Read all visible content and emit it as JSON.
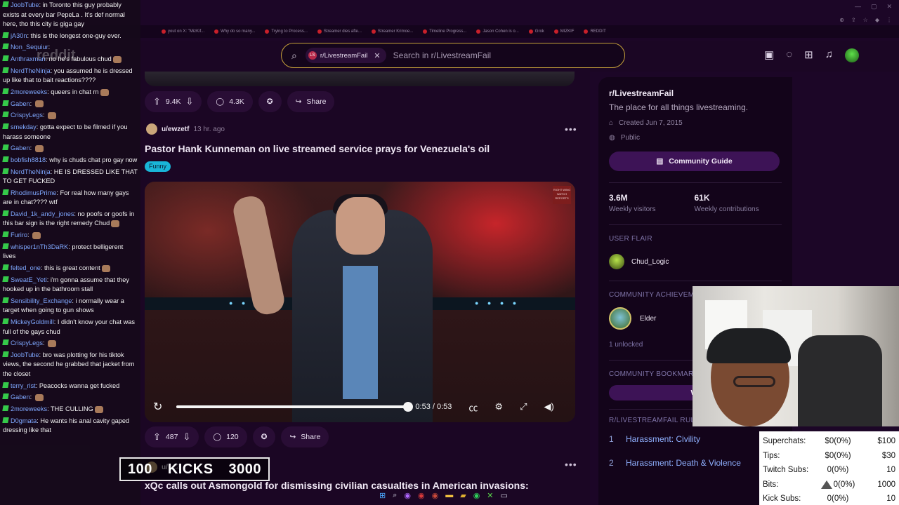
{
  "browser": {
    "bookmarks": [
      "yout on X: \"MizKif...",
      "Why do so many...",
      "Trying to Process...",
      "Streamer dies afte...",
      "Streamer Krimoe...",
      "Timeline Progress...",
      "Jason Cohen is o...",
      "Grok",
      "MIZKIF",
      "REDDIT"
    ]
  },
  "header": {
    "search_chip": "r/LivestreamFail",
    "search_chip_icon": "LS",
    "search_placeholder": "Search in r/LivestreamFail"
  },
  "feed": {
    "prev_post_actions": {
      "upvotes": "9.4K",
      "comments": "4.3K",
      "share": "Share"
    },
    "post": {
      "user": "u/ewzetf",
      "time": "13 hr. ago",
      "title": "Pastor Hank Kunneman on live streamed service prays for Venezuela's oil",
      "flair": "Funny",
      "video_badge": "RIGHT WING WATCH REPORTS",
      "video_time": "0:53 / 0:53",
      "video_progress": 1.0,
      "upvotes": "487",
      "comments": "120",
      "share": "Share"
    },
    "next_post": {
      "user": "u/",
      "time": "12",
      "title": "xQc calls out Asmongold for dismissing civilian casualties in American invasions:"
    }
  },
  "sidebar": {
    "name": "r/LivestreamFail",
    "description": "The place for all things livestreaming.",
    "created": "Created Jun 7, 2015",
    "visibility": "Public",
    "guide_button": "Community Guide",
    "stats": [
      {
        "value": "3.6M",
        "label": "Weekly visitors"
      },
      {
        "value": "61K",
        "label": "Weekly contributions"
      }
    ],
    "user_flair_heading": "USER FLAIR",
    "user_flair": "Chud_Logic",
    "achievements_heading": "COMMUNITY ACHIEVEM",
    "achievement": "Elder",
    "unlocked": "1 unlocked",
    "bookmarks_heading": "COMMUNITY BOOKMAR",
    "bookmark_button": "W",
    "rules_heading": "R/LIVESTREAMFAIL RULES",
    "rules": [
      {
        "num": "1",
        "text": "Harassment: Civility"
      },
      {
        "num": "2",
        "text": "Harassment: Death & Violence"
      }
    ]
  },
  "chat": {
    "watermark": "reddit",
    "messages": [
      {
        "user": "JoobTube",
        "text": "in Toronto this guy probably exists at every bar PepeLa . It's def normal here, tho this city is giga gay"
      },
      {
        "user": "jA30n",
        "text": "this is the longest one-guy ever."
      },
      {
        "user": "Non_Sequiur",
        "text": ""
      },
      {
        "user": "Anthraxman",
        "text": "no he's fabulous chud",
        "emote": true
      },
      {
        "user": "NerdTheNinja",
        "text": "you assumed he is dressed up like that to bait reactions????"
      },
      {
        "user": "2moreweeks",
        "text": "queers in chat rn",
        "emote": true
      },
      {
        "user": "Gaben",
        "text": "",
        "emote": true
      },
      {
        "user": "CrispyLegs",
        "text": "",
        "emote": true
      },
      {
        "user": "smekday",
        "text": "gotta expect to be filmed if you harass someone"
      },
      {
        "user": "Gaben",
        "text": "",
        "emote": true
      },
      {
        "user": "bobfish8818",
        "text": "why is chuds chat pro gay now"
      },
      {
        "user": "NerdTheNinja",
        "text": "HE IS DRESSED LIKE THAT TO GET FUCKED"
      },
      {
        "user": "RhodimusPrime",
        "text": "For real how many gays are in chat???? wtf"
      },
      {
        "user": "David_1k_andy_jones",
        "text": "no poofs or goofs in this bar sign is the right remedy Chud",
        "emote": true
      },
      {
        "user": "Furiro",
        "text": "",
        "emote": true
      },
      {
        "user": "whisper1nTh3DaRK",
        "text": "protect belligerent lives"
      },
      {
        "user": "felted_one",
        "text": "this is great content",
        "emote": true
      },
      {
        "user": "SweatE_Yeti",
        "text": "i'm gonna assume that they hooked up in the bathroom stall"
      },
      {
        "user": "Sensibility_Exchange",
        "text": "i normally wear a target when going to gun shows"
      },
      {
        "user": "MickeyGoldmill",
        "text": "I didn't know your chat was full of the gays chud"
      },
      {
        "user": "CrispyLegs",
        "text": "",
        "emote": true
      },
      {
        "user": "JoobTube",
        "text": "bro was plotting for his tiktok views, the second he grabbed that jacket from the closet"
      },
      {
        "user": "terry_rist",
        "text": "Peacocks wanna get fucked"
      },
      {
        "user": "Gaben",
        "text": "",
        "emote": true
      },
      {
        "user": "2moreweeks",
        "text": "THE CULLING",
        "emote": true
      },
      {
        "user": "D0gmata",
        "text": "He wants his anal cavity gaped dressing like that"
      }
    ]
  },
  "kicks": {
    "left": "100",
    "label": "KICKS",
    "right": "3000"
  },
  "money": [
    {
      "label": "Superchats:",
      "value": "$0(0%)",
      "goal": "$100"
    },
    {
      "label": "Tips:",
      "value": "$0(0%)",
      "goal": "$30"
    },
    {
      "label": "Twitch Subs:",
      "value": "0(0%)",
      "goal": "10"
    },
    {
      "label": "Bits:",
      "value": "0(0%)",
      "goal": "1000",
      "icon": "bits-triangle-icon"
    },
    {
      "label": "Kick Subs:",
      "value": "0(0%)",
      "goal": "10"
    }
  ],
  "colors": {
    "accent_flair": "#19b5d8",
    "search_border": "#c6a13a",
    "sidebar_button": "#3d1356",
    "chat_badge": "#35c94a",
    "chat_user": "#7fa8ff"
  }
}
